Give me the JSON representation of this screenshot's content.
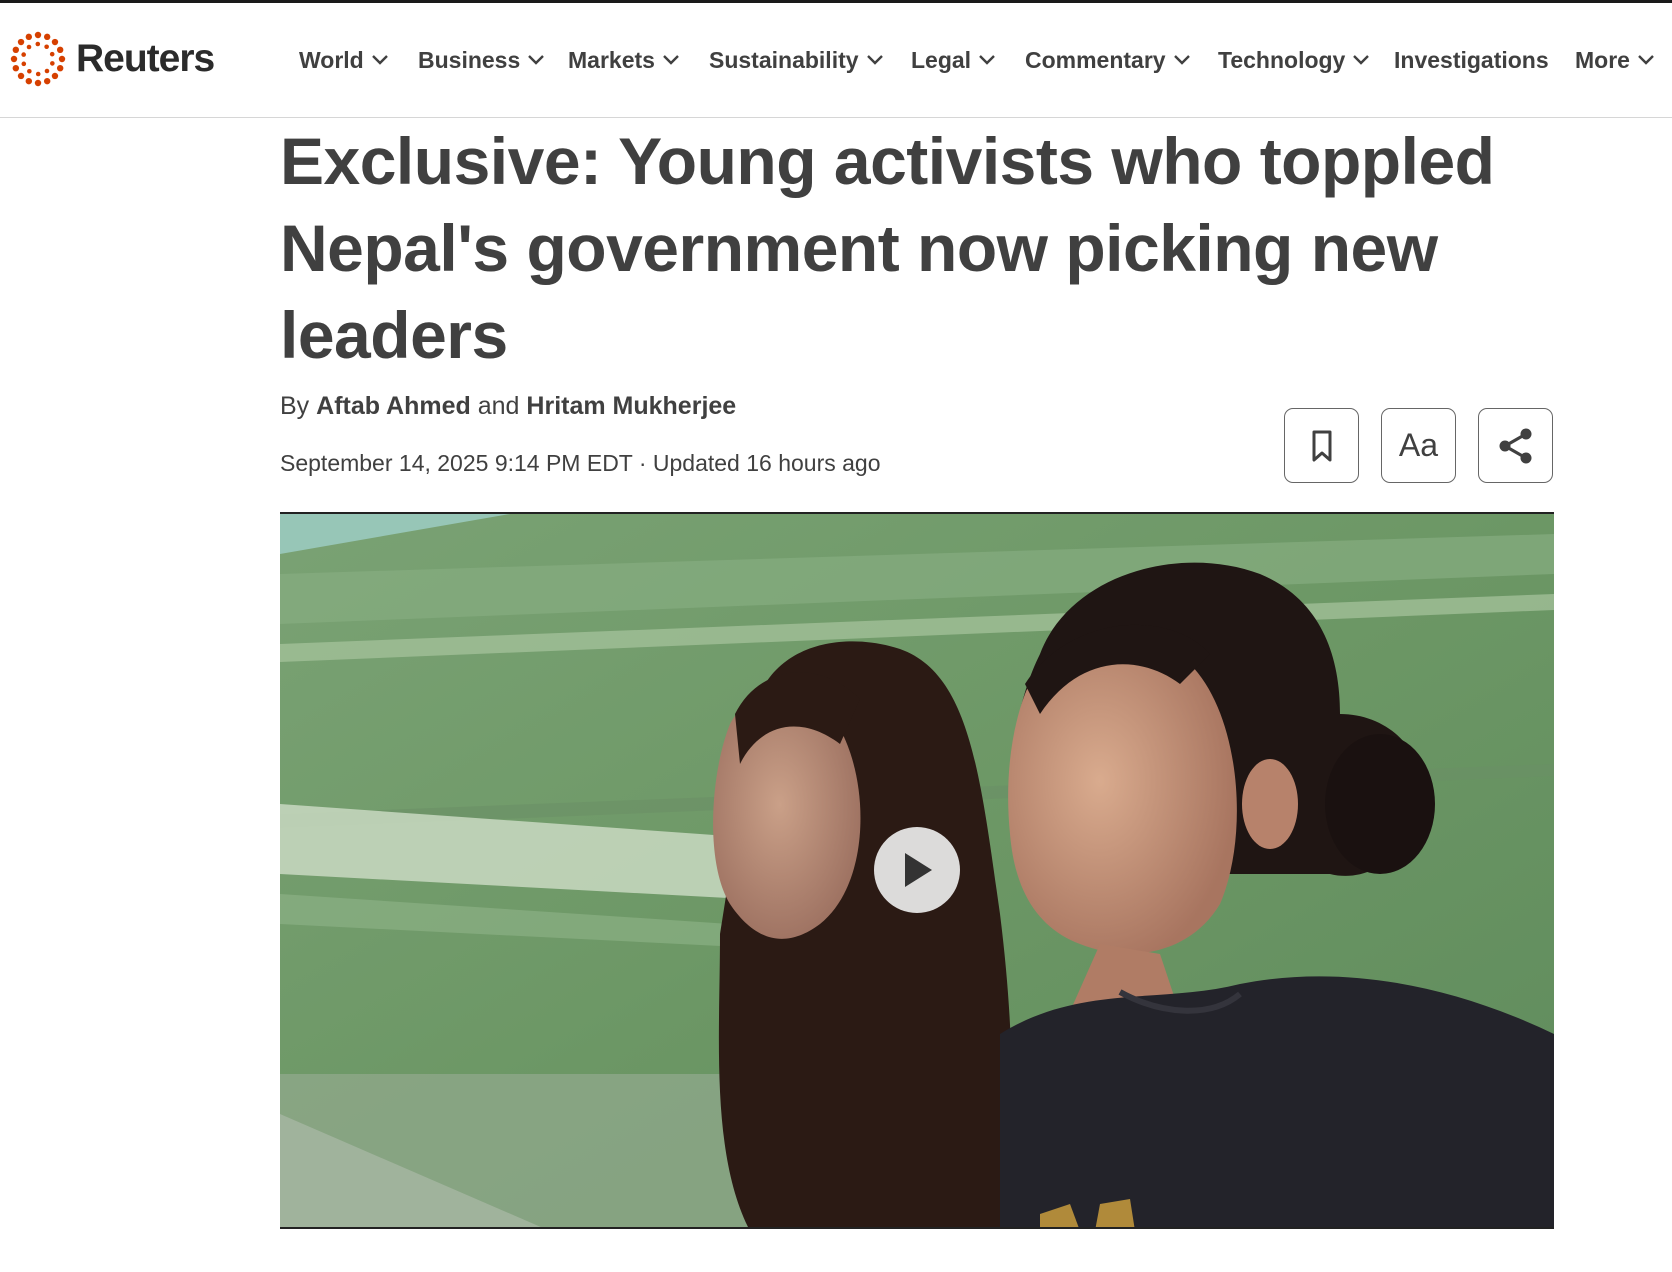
{
  "brand": {
    "name": "Reuters",
    "accent": "#d64000"
  },
  "nav": {
    "items": [
      {
        "label": "World",
        "has_dropdown": true
      },
      {
        "label": "Business",
        "has_dropdown": true
      },
      {
        "label": "Markets",
        "has_dropdown": true
      },
      {
        "label": "Sustainability",
        "has_dropdown": true
      },
      {
        "label": "Legal",
        "has_dropdown": true
      },
      {
        "label": "Commentary",
        "has_dropdown": true
      },
      {
        "label": "Technology",
        "has_dropdown": true
      },
      {
        "label": "Investigations",
        "has_dropdown": false
      },
      {
        "label": "More",
        "has_dropdown": true
      }
    ]
  },
  "article": {
    "headline": "Exclusive: Young activists who toppled Nepal's government now picking new leaders",
    "byline": {
      "prefix": "By",
      "author1": "Aftab Ahmed",
      "conjunction": "and",
      "author2": "Hritam Mukherjee"
    },
    "dateline": "September 14, 2025 9:14 PM EDT · Updated 16 hours ago"
  },
  "toolbar": {
    "bookmark_icon": "bookmark-icon",
    "text_size_label": "Aa",
    "share_icon": "share-icon"
  },
  "media": {
    "play_icon": "play-icon"
  }
}
